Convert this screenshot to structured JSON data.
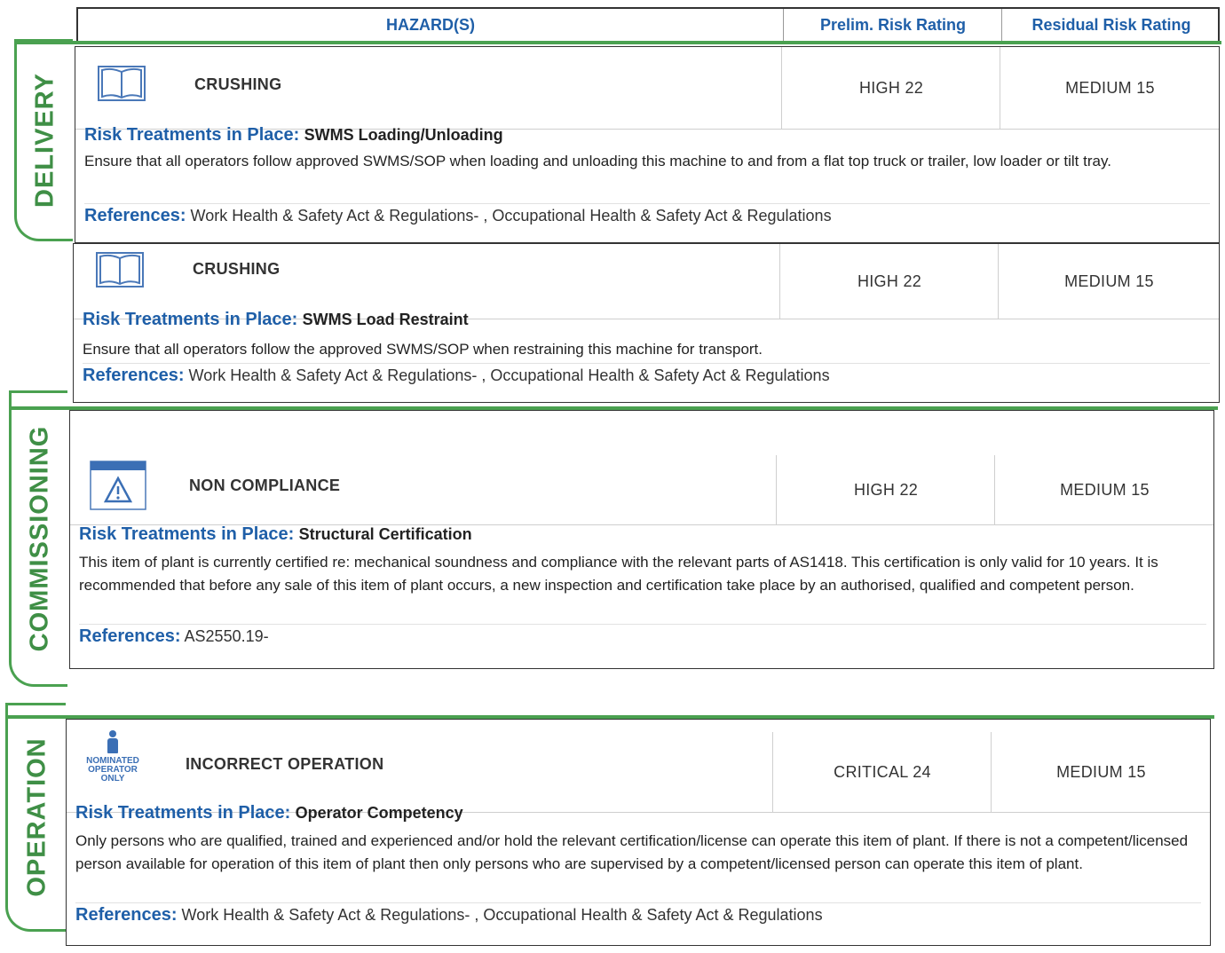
{
  "header": {
    "hazards": "HAZARD(S)",
    "prelim": "Prelim. Risk Rating",
    "residual": "Residual Risk Rating"
  },
  "sections": {
    "delivery": "DELIVERY",
    "commissioning": "COMMISSIONING",
    "operation": "OPERATION"
  },
  "labels": {
    "risk_treatments": "Risk Treatments in Place:",
    "references": "References:"
  },
  "hazards": [
    {
      "icon": "manual-book-icon",
      "name": "CRUSHING",
      "prelim": "HIGH 22",
      "residual": "MEDIUM 15",
      "treatment": "SWMS Loading/Unloading",
      "description": "Ensure that all operators follow approved SWMS/SOP when loading and unloading this machine to and from a flat top truck or trailer, low loader or tilt tray.",
      "references": "Work Health & Safety Act & Regulations- , Occupational Health & Safety Act & Regulations"
    },
    {
      "icon": "manual-book-icon",
      "name": "CRUSHING",
      "prelim": "HIGH 22",
      "residual": "MEDIUM 15",
      "treatment": "SWMS Load Restraint",
      "description": "Ensure that all operators follow the approved SWMS/SOP when restraining this machine for transport.",
      "references": "Work Health & Safety Act & Regulations- , Occupational Health & Safety Act & Regulations"
    },
    {
      "icon": "warning-sign-icon",
      "name": "NON COMPLIANCE",
      "prelim": "HIGH 22",
      "residual": "MEDIUM 15",
      "treatment": "Structural Certification",
      "description": "This item of plant is currently certified re: mechanical soundness and compliance with the relevant parts of AS1418. This certification is only valid for 10 years. It is recommended that before any sale of this item of plant occurs, a new inspection and certification take place by an authorised, qualified and competent person.",
      "references": "AS2550.19-"
    },
    {
      "icon": "nominated-operator-icon",
      "icon_text": [
        "NOMINATED",
        "OPERATOR",
        "ONLY"
      ],
      "name": "INCORRECT OPERATION",
      "prelim": "CRITICAL 24",
      "residual": "MEDIUM 15",
      "treatment": "Operator Competency",
      "description": "Only persons who are qualified, trained and experienced and/or hold the relevant certification/license can operate this item of plant. If there is not a competent/licensed person available for operation of this item of plant then only persons who are supervised by a competent/licensed person can operate this item of plant.",
      "references": "Work Health & Safety Act & Regulations- , Occupational Health & Safety Act & Regulations"
    }
  ]
}
